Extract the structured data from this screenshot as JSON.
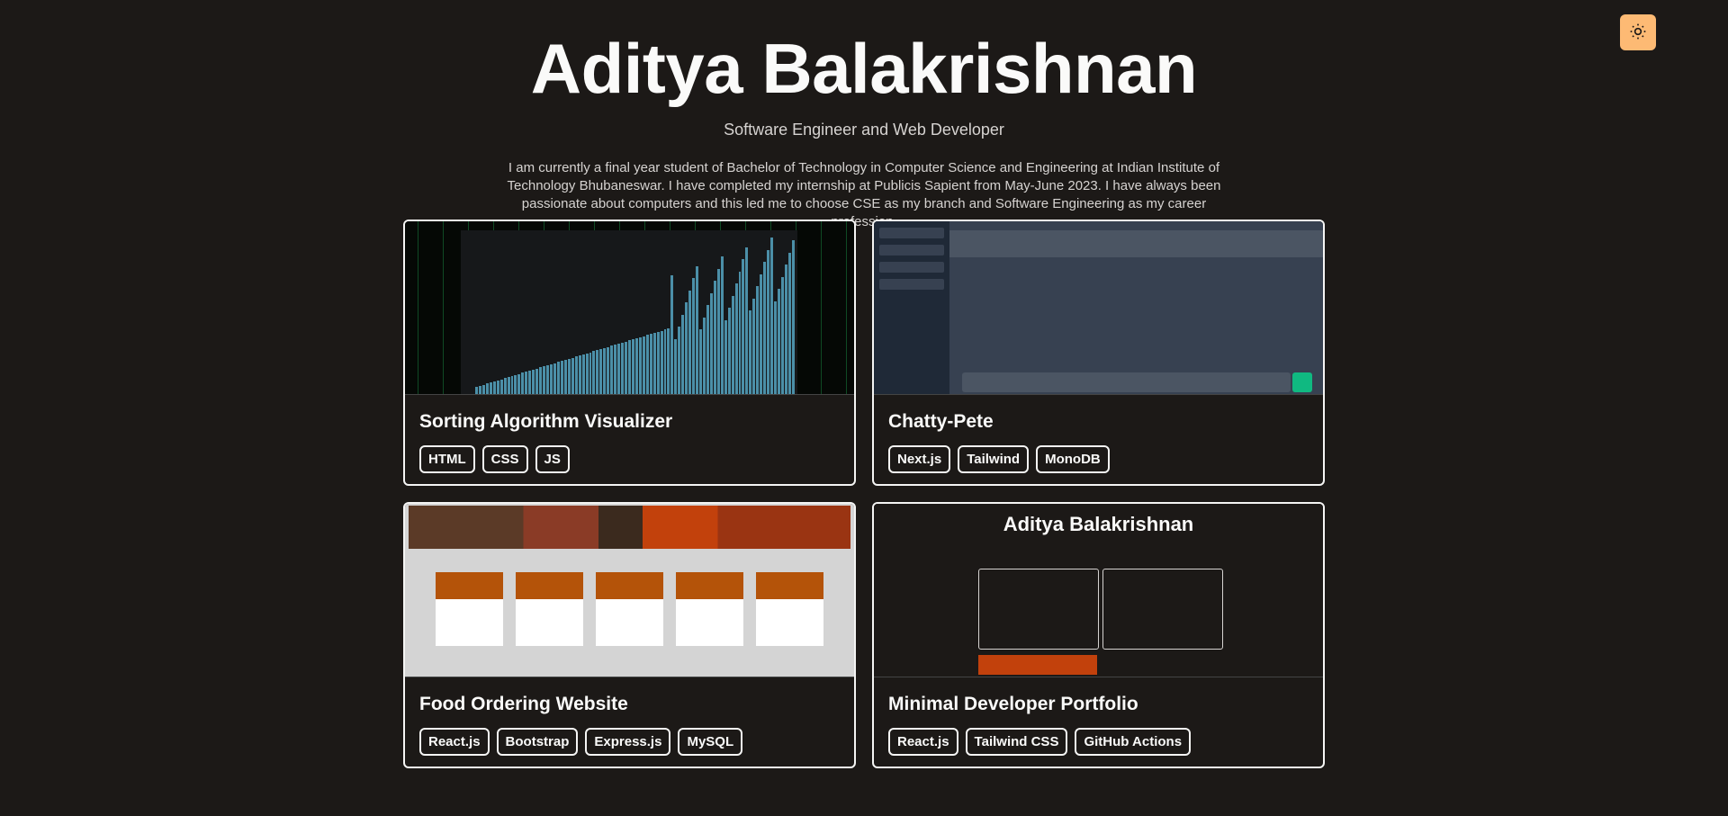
{
  "header": {
    "name": "Aditya Balakrishnan",
    "subtitle": "Software Engineer and Web Developer",
    "bio": "I am currently a final year student of Bachelor of Technology in Computer Science and Engineering at Indian Institute of Technology Bhubaneswar. I have completed my internship at Publicis Sapient from May-June 2023. I have always been passionate about computers and this led me to choose CSE as my branch and Software Engineering as my career profession."
  },
  "theme_toggle": {
    "icon": "sun-icon",
    "color": "#fdba74"
  },
  "projects": [
    {
      "title": "Sorting Algorithm Visualizer",
      "tags": [
        "HTML",
        "CSS",
        "JS"
      ]
    },
    {
      "title": "Chatty-Pete",
      "tags": [
        "Next.js",
        "Tailwind",
        "MonoDB"
      ]
    },
    {
      "title": "Food Ordering Website",
      "tags": [
        "React.js",
        "Bootstrap",
        "Express.js",
        "MySQL"
      ]
    },
    {
      "title": "Minimal Developer Portfolio",
      "tags": [
        "React.js",
        "Tailwind CSS",
        "GitHub Actions"
      ]
    }
  ],
  "colors": {
    "background": "#1c1917",
    "text": "#fafaf9",
    "accent": "#fdba74"
  }
}
